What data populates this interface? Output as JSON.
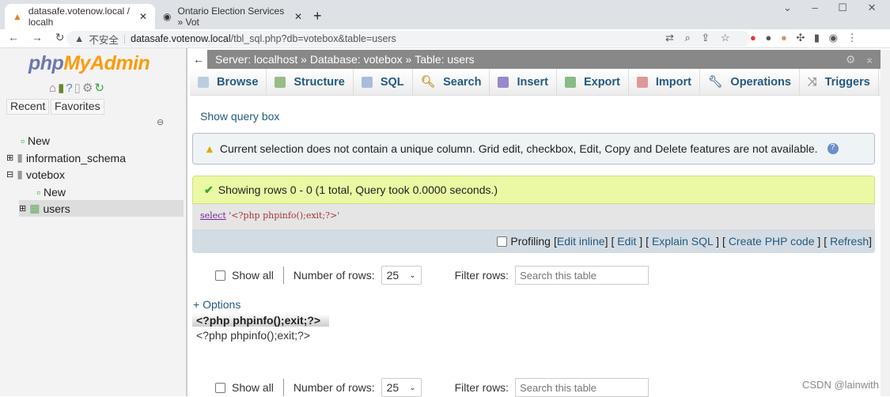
{
  "browser": {
    "tabs": [
      {
        "title": "datasafe.votenow.local / localh",
        "icon": "pma-icon"
      },
      {
        "title": "Ontario Election Services » Vot",
        "icon": "globe-icon"
      }
    ],
    "security": "不安全",
    "url_host": "datasafe.votenow.local",
    "url_path": "/tbl_sql.php?db=votebox&table=users"
  },
  "sidebar": {
    "logo_php": "php",
    "logo_rest": "MyAdmin",
    "recent": "Recent",
    "favorites": "Favorites",
    "tree": [
      {
        "label": "New",
        "level": 0
      },
      {
        "label": "information_schema",
        "level": 0
      },
      {
        "label": "votebox",
        "level": 0
      },
      {
        "label": "New",
        "level": 1
      },
      {
        "label": "users",
        "level": 1,
        "selected": true
      }
    ]
  },
  "breadcrumb": {
    "server": "Server: localhost",
    "database": "Database: votebox",
    "table": "Table: users",
    "sep": "»"
  },
  "tabs": [
    "Browse",
    "Structure",
    "SQL",
    "Search",
    "Insert",
    "Export",
    "Import",
    "Operations",
    "Triggers"
  ],
  "main": {
    "show_query_box": "Show query box",
    "warning": "Current selection does not contain a unique column. Grid edit, checkbox, Edit, Copy and Delete features are not available.",
    "success": "Showing rows 0 - 0 (1 total, Query took 0.0000 seconds.)",
    "sql_keyword": "select",
    "sql_rest": "'<?php phpinfo();exit;?>'",
    "profiling": "Profiling",
    "links": [
      "Edit inline",
      "Edit",
      "Explain SQL",
      "Create PHP code",
      "Refresh"
    ],
    "show_all": "Show all",
    "num_rows_label": "Number of rows:",
    "num_rows": "25",
    "filter_label": "Filter rows:",
    "filter_placeholder": "Search this table",
    "options": "+ Options",
    "column_header": "<?php phpinfo();exit;?>",
    "cell": "<?php phpinfo();exit;?>"
  },
  "watermark": "CSDN @lainwith"
}
